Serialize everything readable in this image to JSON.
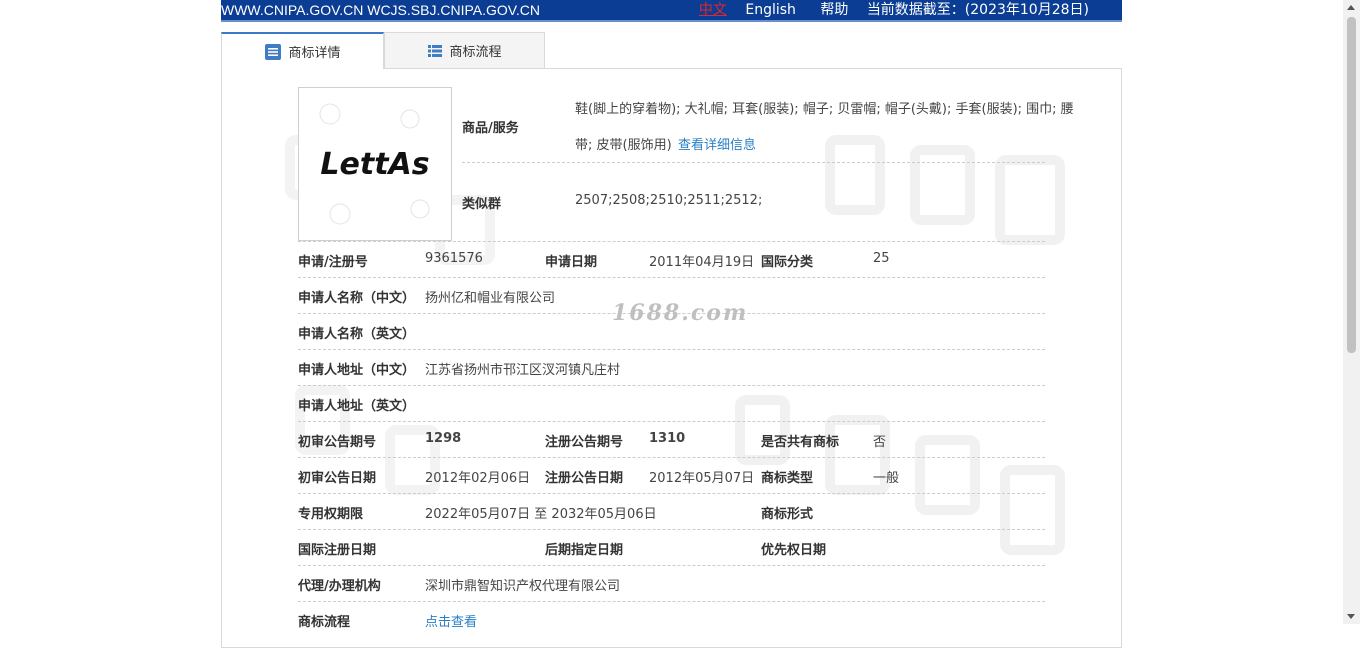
{
  "topbar": {
    "site": "WWW.CNIPA.GOV.CN WCJS.SBJ.CNIPA.GOV.CN",
    "lang_zh": "中文",
    "lang_en": "English",
    "help": "帮助",
    "data_as_of": "当前数据截至：(2023年10月28日)"
  },
  "tabs": {
    "detail": "商标详情",
    "flow": "商标流程"
  },
  "trademark": {
    "logo_text": "LettAs",
    "goods_label": "商品/服务",
    "goods_line1": "鞋(脚上的穿着物); 大礼帽; 耳套(服装); 帽子; 贝雷帽; 帽子(头戴); 手套(服装); 围巾; 腰",
    "goods_line2": "带; 皮带(服饰用)",
    "goods_more": "查看详细信息",
    "similar_label": "类似群",
    "similar_value": "2507;2508;2510;2511;2512;",
    "reg_no_label": "申请/注册号",
    "reg_no": "9361576",
    "apply_date_label": "申请日期",
    "apply_date": "2011年04月19日",
    "intl_class_label": "国际分类",
    "intl_class": "25",
    "applicant_cn_label": "申请人名称（中文）",
    "applicant_cn": "扬州亿和帽业有限公司",
    "applicant_en_label": "申请人名称（英文）",
    "address_cn_label": "申请人地址（中文）",
    "address_cn": "江苏省扬州市邗江区汊河镇凡庄村",
    "address_en_label": "申请人地址（英文）",
    "prelim_no_label": "初审公告期号",
    "prelim_no": "1298",
    "reg_pub_no_label": "注册公告期号",
    "reg_pub_no": "1310",
    "shared_label": "是否共有商标",
    "shared": "否",
    "prelim_date_label": "初审公告日期",
    "prelim_date": "2012年02月06日",
    "reg_pub_date_label": "注册公告日期",
    "reg_pub_date": "2012年05月07日",
    "tm_type_label": "商标类型",
    "tm_type": "一般",
    "exclusive_label": "专用权期限",
    "exclusive": "2022年05月07日 至 2032年05月06日",
    "tm_form_label": "商标形式",
    "intl_reg_date_label": "国际注册日期",
    "later_designation_label": "后期指定日期",
    "priority_date_label": "优先权日期",
    "agent_label": "代理/办理机构",
    "agent": "深圳市鼎智知识产权代理有限公司",
    "flow_label": "商标流程",
    "flow_link": "点击查看"
  },
  "watermark": "1688.com",
  "colors": {
    "topbar": "#0a3d93",
    "link": "#2a7fc7",
    "active_tab": "#3a78c8"
  }
}
